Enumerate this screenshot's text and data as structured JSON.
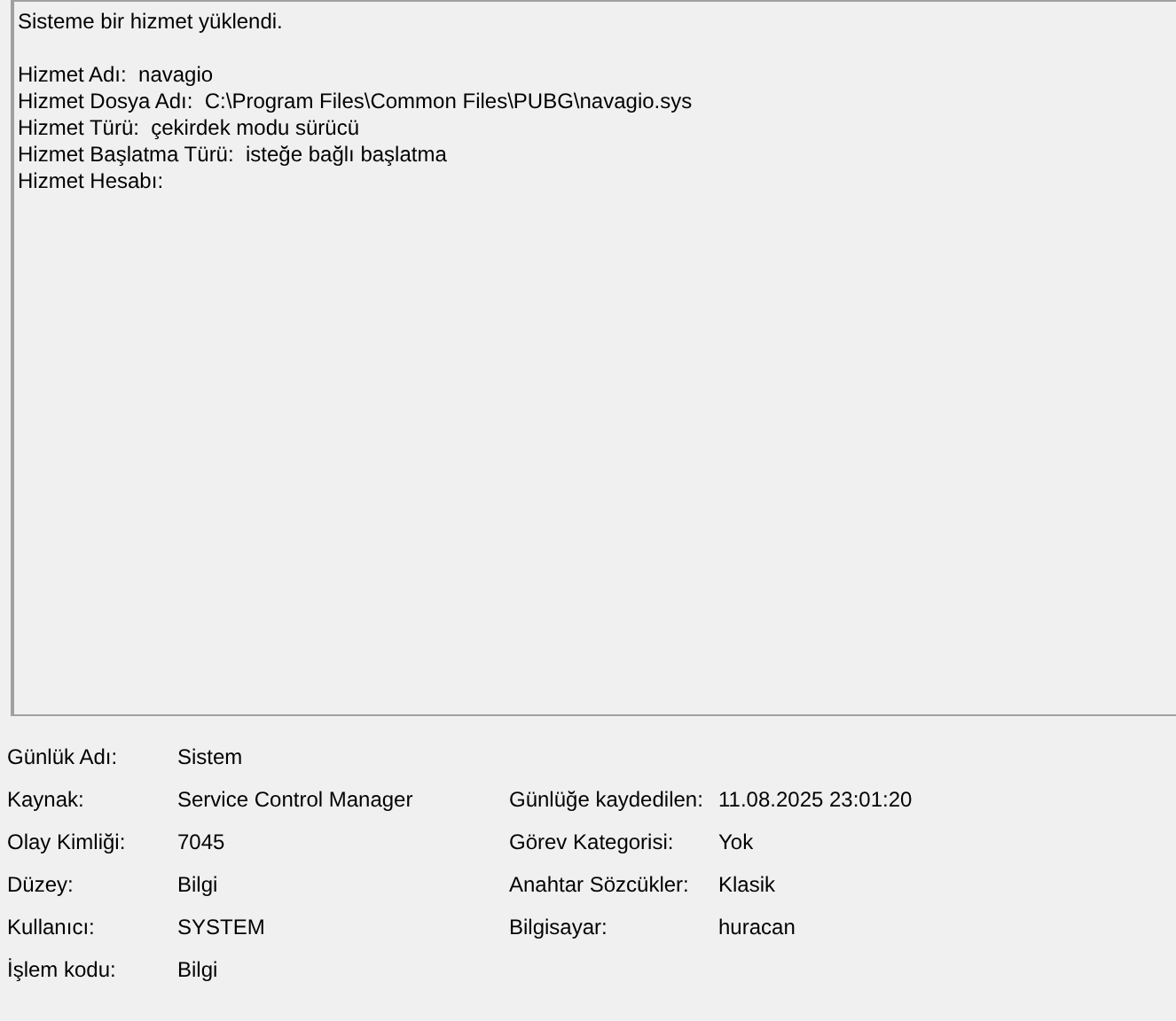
{
  "description": {
    "summary": "Sisteme bir hizmet yüklendi.",
    "lines": [
      {
        "label": "Hizmet Adı:",
        "value": "navagio"
      },
      {
        "label": "Hizmet Dosya Adı:",
        "value": "C:\\Program Files\\Common Files\\PUBG\\navagio.sys"
      },
      {
        "label": "Hizmet Türü:",
        "value": "çekirdek modu sürücü"
      },
      {
        "label": "Hizmet Başlatma Türü:",
        "value": "isteğe bağlı başlatma"
      },
      {
        "label": "Hizmet Hesabı:"
      }
    ]
  },
  "details": [
    {
      "left": {
        "label": "Günlük Adı:",
        "value": "Sistem"
      }
    },
    {
      "left": {
        "label": "Kaynak:",
        "value": "Service Control Manager"
      },
      "right": {
        "label": "Günlüğe kaydedilen:",
        "value": "11.08.2025 23:01:20"
      }
    },
    {
      "left": {
        "label": "Olay Kimliği:",
        "value": "7045"
      },
      "right": {
        "label": "Görev Kategorisi:",
        "value": "Yok"
      }
    },
    {
      "left": {
        "label": "Düzey:",
        "value": "Bilgi"
      },
      "right": {
        "label": "Anahtar Sözcükler:",
        "value": "Klasik"
      }
    },
    {
      "left": {
        "label": "Kullanıcı:",
        "value": "SYSTEM"
      },
      "right": {
        "label": "Bilgisayar:",
        "value": "huracan"
      }
    },
    {
      "left": {
        "label": "İşlem kodu:",
        "value": "Bilgi"
      }
    }
  ]
}
